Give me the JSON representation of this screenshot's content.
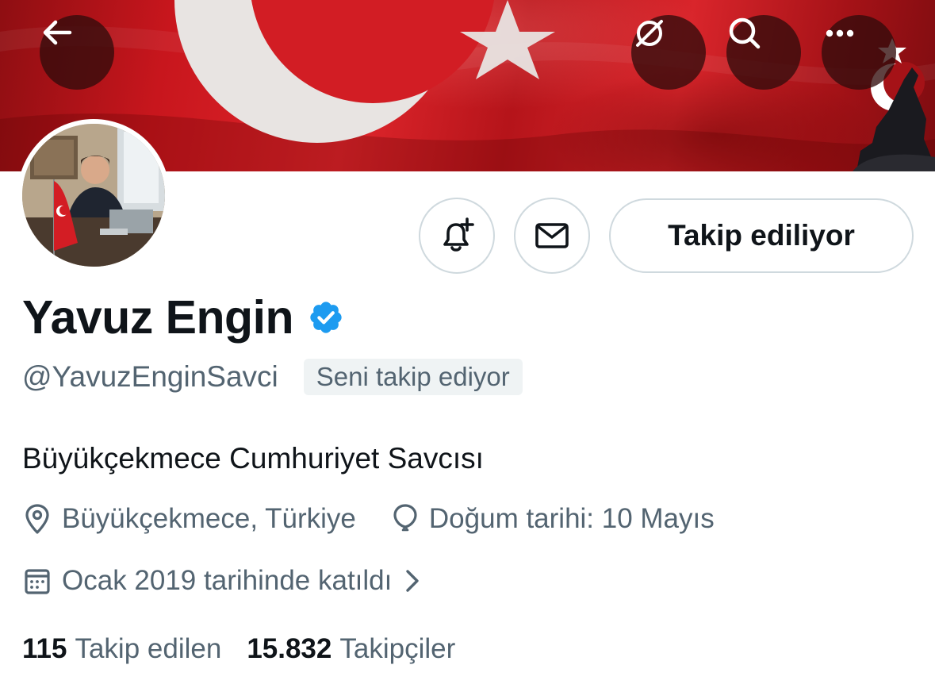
{
  "header": {
    "back_icon": "arrow-left-icon",
    "grok_icon": "grok-icon",
    "search_icon": "search-icon",
    "more_icon": "more-dots-icon"
  },
  "profile": {
    "name": "Yavuz Engin",
    "verified": true,
    "handle": "@YavuzEnginSavci",
    "follows_you_label": "Seni takip ediyor",
    "bio": "Büyükçekmece Cumhuriyet Savcısı",
    "location": "Büyükçekmece, Türkiye",
    "birthday": "Doğum tarihi: 10 Mayıs",
    "joined": "Ocak 2019 tarihinde katıldı"
  },
  "actions": {
    "notify_icon": "bell-plus-icon",
    "message_icon": "envelope-icon",
    "follow_label": "Takip ediliyor"
  },
  "stats": {
    "following_count": "115",
    "following_label": "Takip edilen",
    "followers_count": "15.832",
    "followers_label": "Takipçiler"
  },
  "colors": {
    "text_primary": "#0f1419",
    "text_secondary": "#536471",
    "verified_blue": "#1d9bf0",
    "border": "#cfd9de",
    "banner_red": "#d9252b"
  }
}
